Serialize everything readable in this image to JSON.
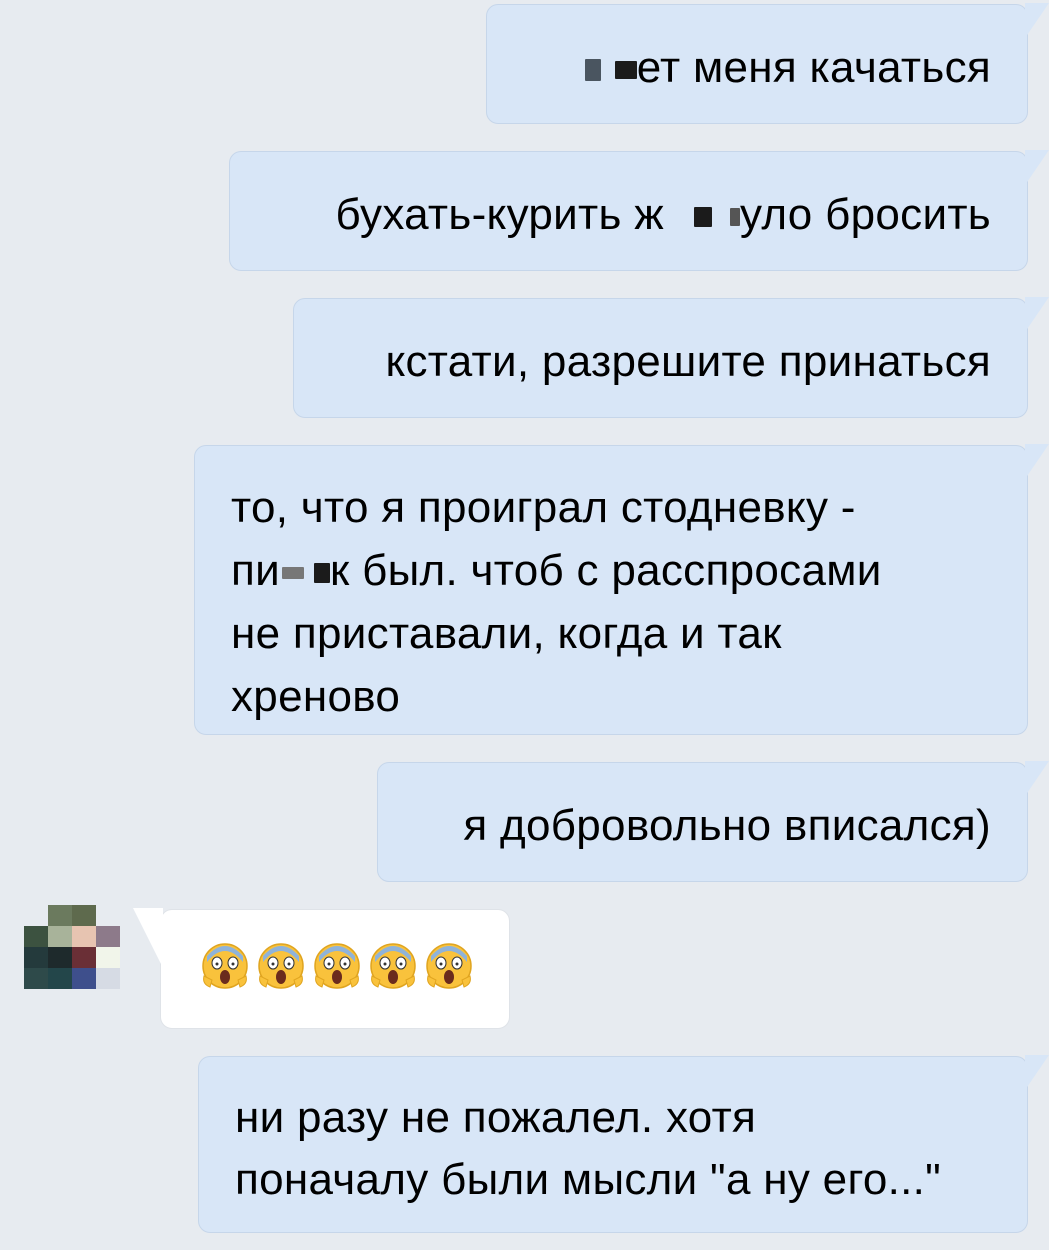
{
  "messages": [
    {
      "id": "m1",
      "direction": "out",
      "text_before": "",
      "text_after": "ет меня качаться"
    },
    {
      "id": "m2",
      "direction": "out",
      "text_before": "бухать-курить ж",
      "text_after": "уло бросить"
    },
    {
      "id": "m3",
      "direction": "out",
      "text": "кстати, разрешите принаться"
    },
    {
      "id": "m4",
      "direction": "out",
      "line1": "то, что я проиграл стодневку -",
      "line2_before": "пи",
      "line2_after": "к был. чтоб с расспросами",
      "line3": "не приставали, когда и так",
      "line4": "хреново"
    },
    {
      "id": "m5",
      "direction": "out",
      "text": "я добровольно вписался)"
    },
    {
      "id": "m6",
      "direction": "in",
      "emoji_count": 5,
      "emoji": "face-screaming-in-fear"
    },
    {
      "id": "m7",
      "direction": "out",
      "line1": "ни разу не пожалел. хотя",
      "line2": "поначалу были мысли \"а ну его...\""
    }
  ],
  "avatar": {
    "icon": "pixelated-avatar-icon"
  },
  "colors": {
    "background": "#e7ebf0",
    "outgoing_bubble": "#d8e6f7",
    "incoming_bubble": "#ffffff",
    "emoji_face": "#f9c23c"
  }
}
